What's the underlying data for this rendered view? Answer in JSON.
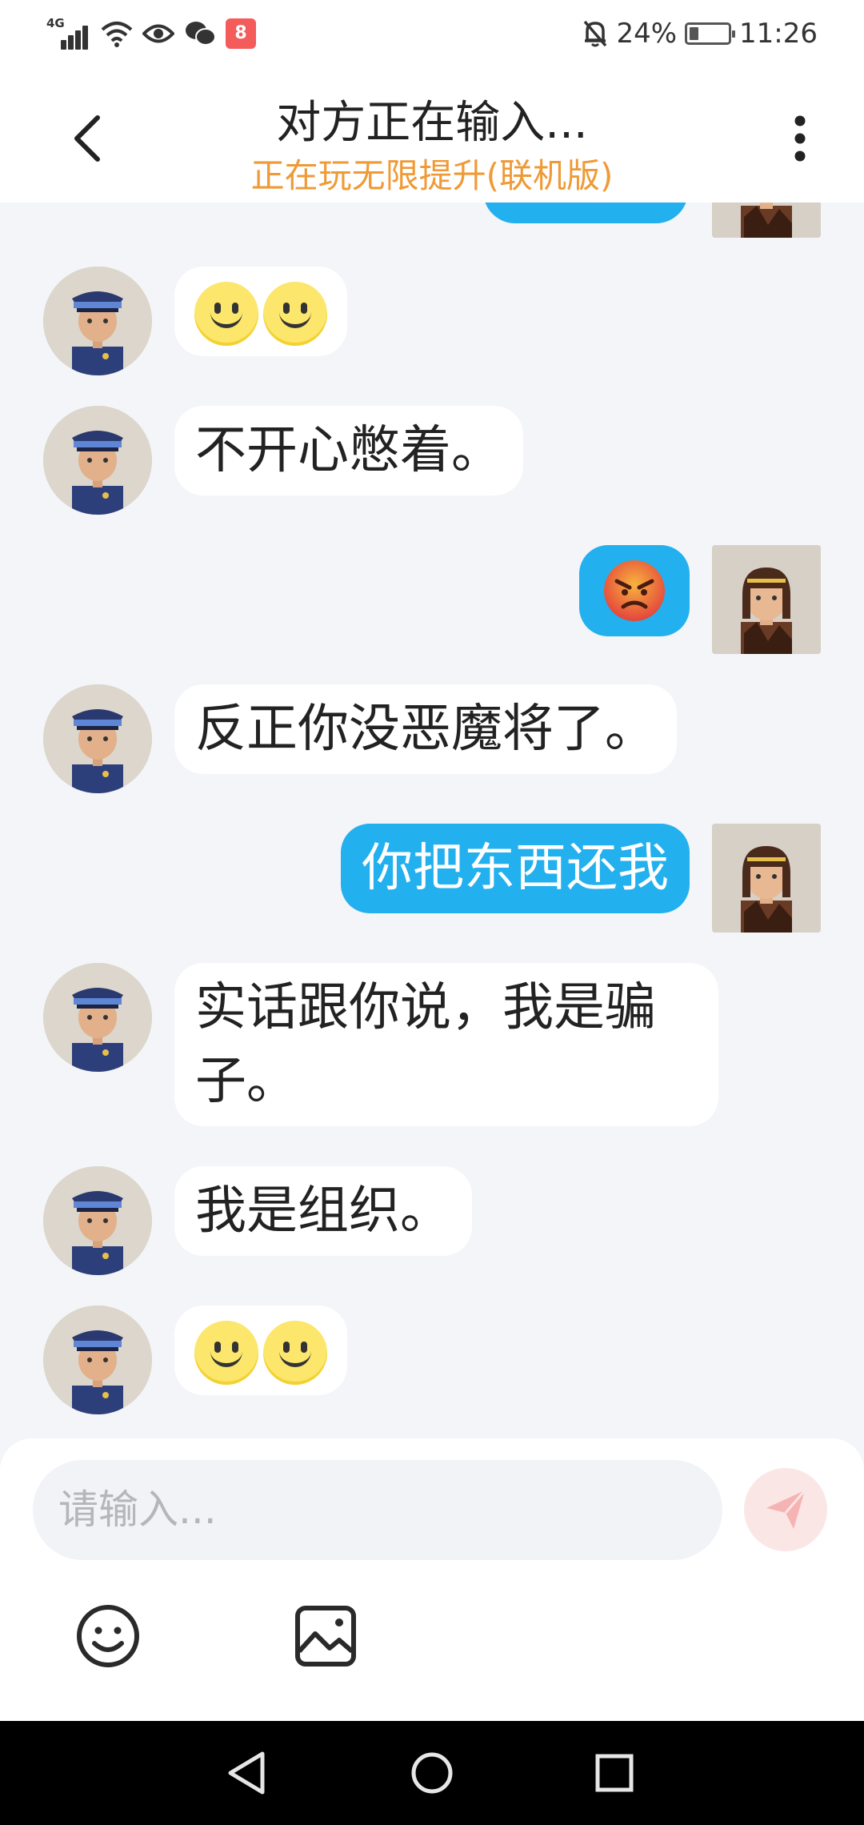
{
  "status_bar": {
    "network": "4G",
    "app_badge": "8",
    "battery_text": "24%",
    "battery_level": 0.24,
    "time": "11:26",
    "icons": [
      "signal-icon",
      "wifi-icon",
      "eye-icon",
      "wechat-icon",
      "app-notification-icon",
      "mute-bell-icon",
      "battery-icon"
    ]
  },
  "header": {
    "title": "对方正在输入...",
    "subtitle": "正在玩无限提升(联机版)",
    "subtitle_color": "#ef9a36"
  },
  "messages": [
    {
      "side": "right",
      "type": "bubble-partial",
      "avatar": "girl-avatar"
    },
    {
      "side": "left",
      "type": "emoji",
      "emoji": [
        "slightly-smiling-face",
        "slightly-smiling-face"
      ],
      "avatar": "police-avatar"
    },
    {
      "side": "left",
      "type": "text",
      "text": "不开心憋着。",
      "avatar": "police-avatar"
    },
    {
      "side": "right",
      "type": "emoji",
      "emoji": [
        "angry-face"
      ],
      "avatar": "girl-avatar"
    },
    {
      "side": "left",
      "type": "text",
      "text": "反正你没恶魔将了。",
      "avatar": "police-avatar"
    },
    {
      "side": "right",
      "type": "text",
      "text": "你把东西还我",
      "avatar": "girl-avatar"
    },
    {
      "side": "left",
      "type": "text",
      "text": "实话跟你说，我是骗子。",
      "avatar": "police-avatar"
    },
    {
      "side": "left",
      "type": "text",
      "text": "我是组织。",
      "avatar": "police-avatar"
    },
    {
      "side": "left",
      "type": "emoji",
      "emoji": [
        "slightly-smiling-face",
        "slightly-smiling-face"
      ],
      "avatar": "police-avatar"
    }
  ],
  "input": {
    "placeholder": "请输入..."
  },
  "colors": {
    "accent_bubble": "#23b0ee",
    "background": "#f3f5f8",
    "send_button": "#fbe6e6"
  }
}
